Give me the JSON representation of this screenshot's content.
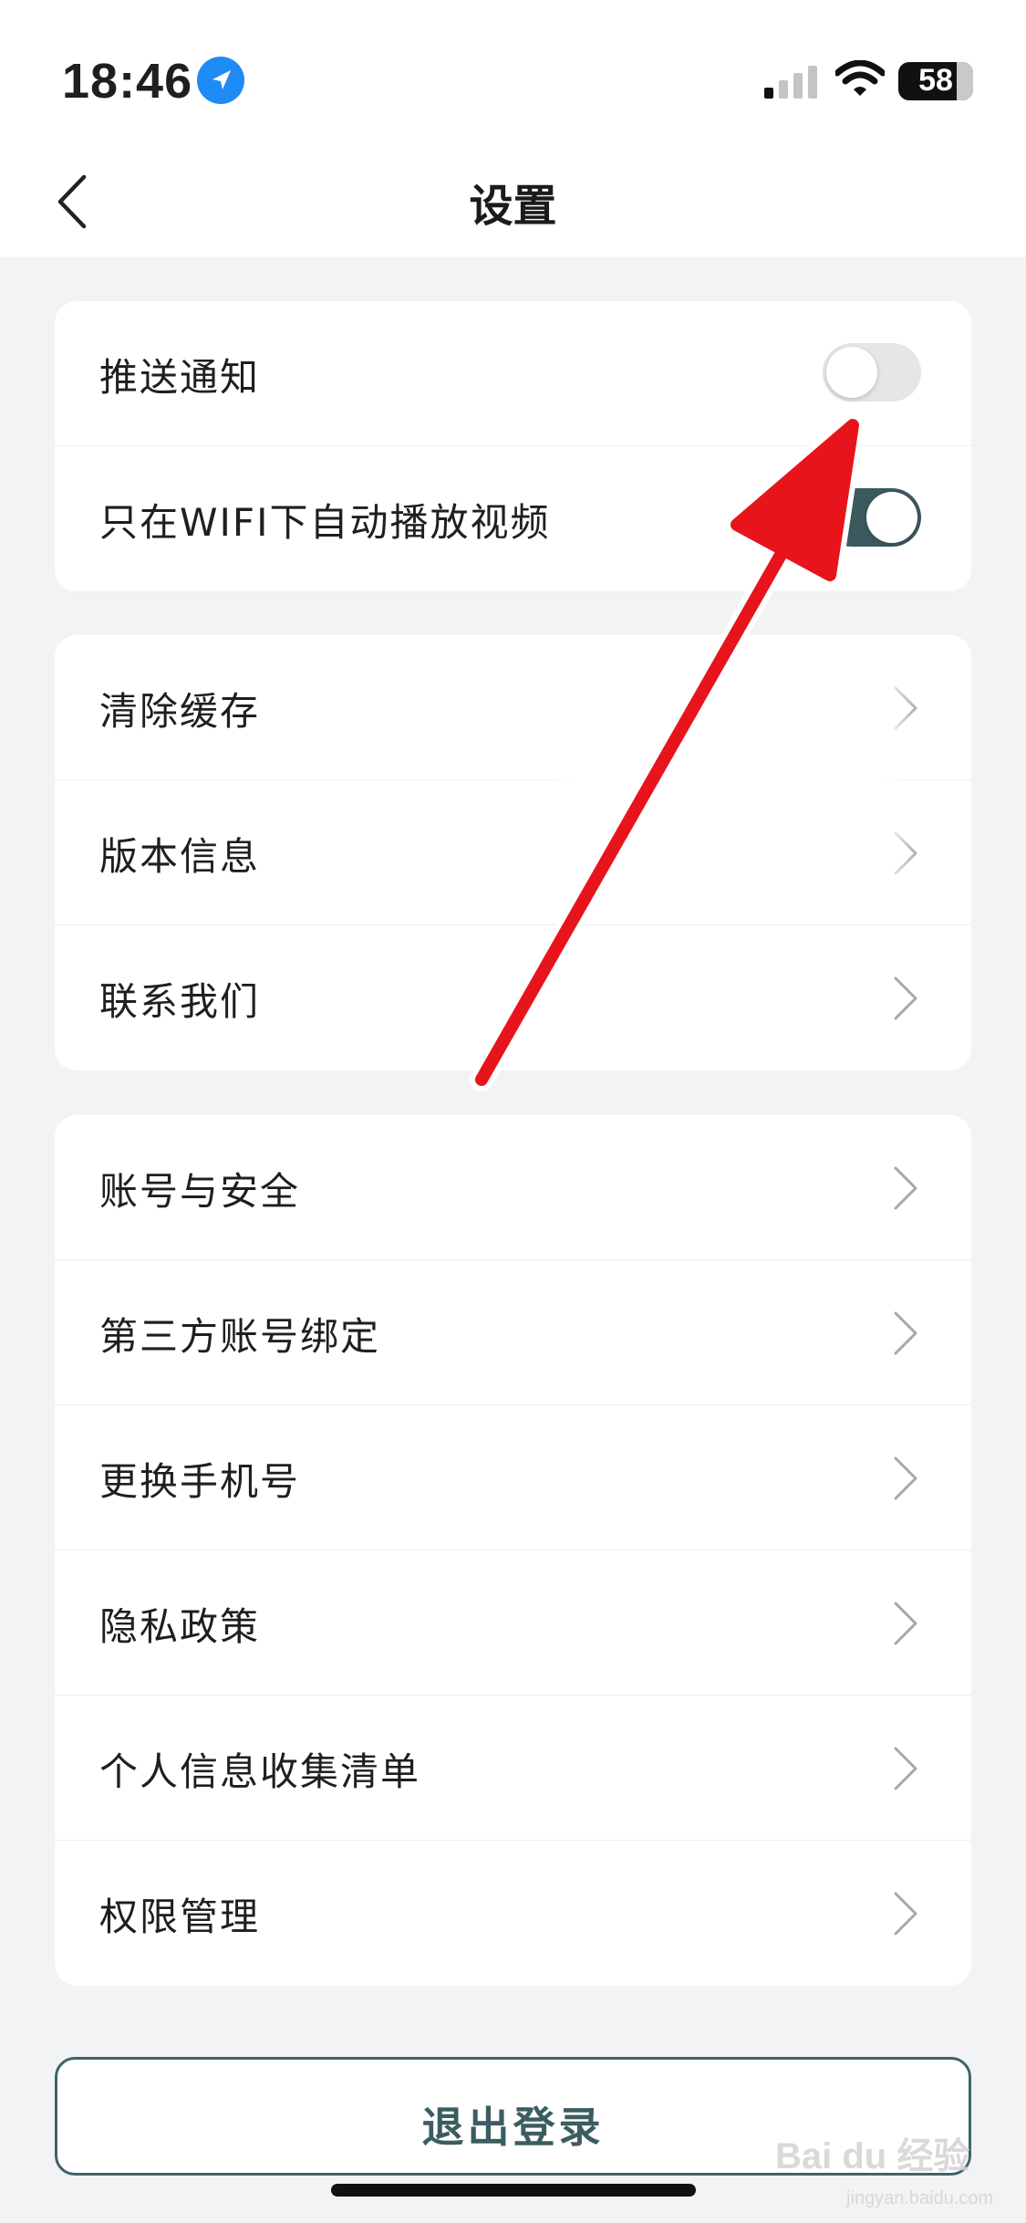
{
  "status_bar": {
    "time": "18:46",
    "battery": "58",
    "icons": [
      "location-icon",
      "signal-icon",
      "wifi-icon",
      "battery-icon"
    ]
  },
  "nav": {
    "title": "设置",
    "back_icon": "chevron-left-icon"
  },
  "group1": [
    {
      "label": "推送通知",
      "toggle": false
    },
    {
      "label": "只在WIFI下自动播放视频",
      "toggle": true
    }
  ],
  "group2": [
    {
      "label": "清除缓存"
    },
    {
      "label": "版本信息"
    },
    {
      "label": "联系我们"
    }
  ],
  "group3": [
    {
      "label": "账号与安全"
    },
    {
      "label": "第三方账号绑定"
    },
    {
      "label": "更换手机号"
    },
    {
      "label": "隐私政策"
    },
    {
      "label": "个人信息收集清单"
    },
    {
      "label": "权限管理"
    }
  ],
  "logout": {
    "label": "退出登录"
  },
  "watermark": {
    "text": "Bai du 经验",
    "sub": "jingyan.baidu.com"
  },
  "colors": {
    "accent": "#3b5a5e",
    "background": "#f2f3f5",
    "toggle_off": "#e6e6e6",
    "annotation": "#e8141c"
  }
}
